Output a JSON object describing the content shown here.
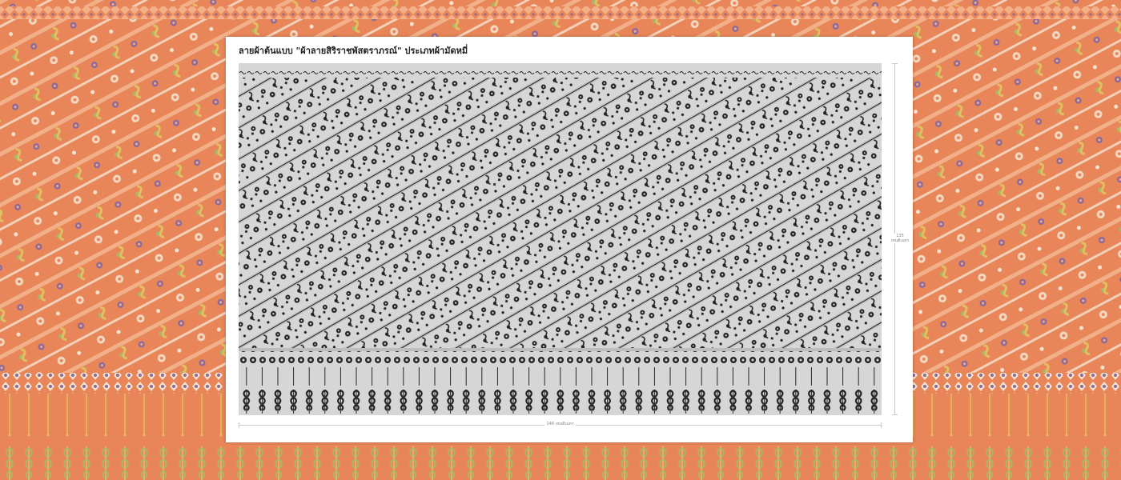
{
  "title": "ลายผ้าต้นแบบ \"ผ้าลายสิริราชพัสตราภรณ์\" ประเภทผ้ามัดหมี่",
  "dimensions": {
    "width_label": "246 เซนติเมตร",
    "height_value": "135",
    "height_unit": "เซนติเมตร"
  },
  "colors": {
    "background_orange": "#e8865a",
    "motif_cream": "#f6e3cf",
    "motif_gold": "#e0c060",
    "motif_green": "#a8b865",
    "motif_purple": "#8a6a9a",
    "motif_pink": "#f3a58a",
    "panel_grey": "#d6d6d6",
    "motif_black": "#222222"
  }
}
